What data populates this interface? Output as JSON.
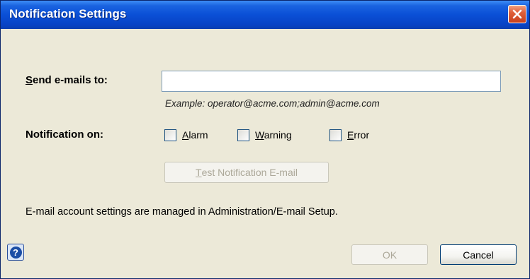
{
  "dialog": {
    "title": "Notification Settings"
  },
  "form": {
    "send_label_prefix": "S",
    "send_label_rest": "end e-mails to:",
    "email_value": "",
    "example_text": "Example:  operator@acme.com;admin@acme.com",
    "notify_label": "Notification on:",
    "alarm_prefix": "A",
    "alarm_rest": "larm",
    "warning_prefix": "W",
    "warning_rest": "arning",
    "error_prefix": "E",
    "error_rest": "rror",
    "alarm_checked": false,
    "warning_checked": false,
    "error_checked": false,
    "test_prefix": "T",
    "test_rest": "est Notification E-mail",
    "info_text": "E-mail account settings are managed in Administration/E-mail Setup."
  },
  "footer": {
    "ok_label": "OK",
    "cancel_label": "Cancel"
  },
  "icons": {
    "close": "close-icon",
    "help": "help-icon"
  },
  "colors": {
    "titlebar": "#0a4fd6",
    "close_button": "#e0603a",
    "dialog_background": "#ece9d8"
  }
}
